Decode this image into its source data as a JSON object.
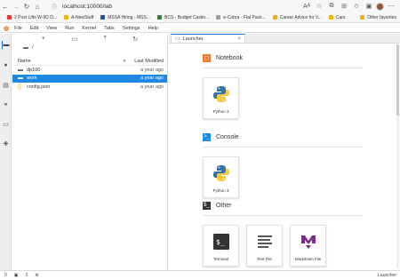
{
  "browser": {
    "url": "localhost:10000/lab",
    "bookmarks": [
      {
        "label": "2 Post Lifts W-9D D...",
        "color": "#e53935"
      },
      {
        "label": "A-NewStuff",
        "color": "#f6b400"
      },
      {
        "label": "MSSA Hiring - MSS...",
        "color": "#1e4fa0"
      },
      {
        "label": "BCS - Budget Castin...",
        "color": "#2e7d32"
      },
      {
        "label": "e-Cobra - Flat Pack...",
        "color": "#9e9e9e"
      },
      {
        "label": "Career Advice for V...",
        "color": "#f6b400"
      },
      {
        "label": "Cars",
        "color": "#f6b400"
      }
    ],
    "other_favorites": "Other favorites"
  },
  "menubar": {
    "items": [
      "File",
      "Edit",
      "View",
      "Run",
      "Kernel",
      "Tabs",
      "Settings",
      "Help"
    ]
  },
  "filebrowser": {
    "breadcrumb": "/",
    "col_name": "Name",
    "col_modified": "Last Modified",
    "rows": [
      {
        "name": "dp100",
        "modified": "a year ago",
        "icon": "folder-icon"
      },
      {
        "name": "work",
        "modified": "a year ago",
        "icon": "folder-icon"
      },
      {
        "name": "config.json",
        "modified": "a year ago",
        "icon": "json-file-icon"
      }
    ]
  },
  "tab": {
    "label": "Launcher"
  },
  "launcher": {
    "notebook_title": "Notebook",
    "notebook_kernel": "Python 3",
    "console_title": "Console",
    "console_kernel": "Python 3",
    "other_title": "Other",
    "other_items": [
      "Terminal",
      "Text File",
      "Markdown File"
    ]
  },
  "status": {
    "left_0": "0",
    "left_1": "0",
    "right": "Launcher"
  },
  "colors": {
    "accent": "#1976d2",
    "selection": "#1e88e5",
    "jupyter_orange": "#f37726",
    "markdown_purple": "#7b2d8e"
  }
}
